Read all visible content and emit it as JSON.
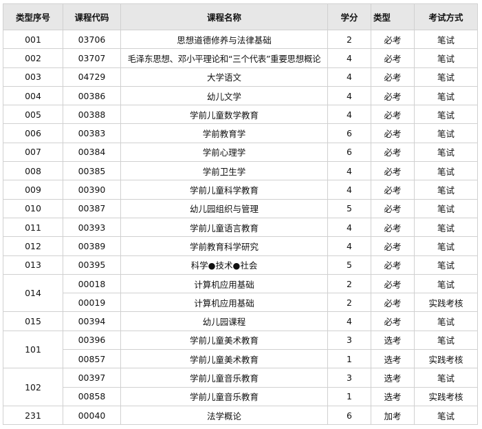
{
  "headers": {
    "seq": "类型序号",
    "code": "课程代码",
    "name": "课程名称",
    "credit": "学分",
    "type": "类型",
    "exam": "考试方式"
  },
  "rows": [
    {
      "seq": "001",
      "code": "03706",
      "name": "思想道德修养与法律基础",
      "credit": "2",
      "type": "必考",
      "exam": "笔试"
    },
    {
      "seq": "002",
      "code": "03707",
      "name": "毛泽东思想、邓小平理论和“三个代表”重要思想概论",
      "credit": "4",
      "type": "必考",
      "exam": "笔试"
    },
    {
      "seq": "003",
      "code": "04729",
      "name": "大学语文",
      "credit": "4",
      "type": "必考",
      "exam": "笔试"
    },
    {
      "seq": "004",
      "code": "00386",
      "name": "幼儿文学",
      "credit": "4",
      "type": "必考",
      "exam": "笔试"
    },
    {
      "seq": "005",
      "code": "00388",
      "name": "学前儿童数学教育",
      "credit": "4",
      "type": "必考",
      "exam": "笔试"
    },
    {
      "seq": "006",
      "code": "00383",
      "name": "学前教育学",
      "credit": "6",
      "type": "必考",
      "exam": "笔试"
    },
    {
      "seq": "007",
      "code": "00384",
      "name": "学前心理学",
      "credit": "6",
      "type": "必考",
      "exam": "笔试"
    },
    {
      "seq": "008",
      "code": "00385",
      "name": "学前卫生学",
      "credit": "4",
      "type": "必考",
      "exam": "笔试"
    },
    {
      "seq": "009",
      "code": "00390",
      "name": "学前儿童科学教育",
      "credit": "4",
      "type": "必考",
      "exam": "笔试"
    },
    {
      "seq": "010",
      "code": "00387",
      "name": "幼儿园组织与管理",
      "credit": "5",
      "type": "必考",
      "exam": "笔试"
    },
    {
      "seq": "011",
      "code": "00393",
      "name": "学前儿童语言教育",
      "credit": "4",
      "type": "必考",
      "exam": "笔试"
    },
    {
      "seq": "012",
      "code": "00389",
      "name": "学前教育科学研究",
      "credit": "4",
      "type": "必考",
      "exam": "笔试"
    },
    {
      "seq": "013",
      "code": "00395",
      "name": "科学●技术●社会",
      "credit": "5",
      "type": "必考",
      "exam": "笔试"
    },
    {
      "seq": "014",
      "code": "00018",
      "name": "计算机应用基础",
      "credit": "2",
      "type": "必考",
      "exam": "笔试"
    },
    {
      "seq": "",
      "code": "00019",
      "name": "计算机应用基础",
      "credit": "2",
      "type": "必考",
      "exam": "实践考核"
    },
    {
      "seq": "015",
      "code": "00394",
      "name": "幼儿园课程",
      "credit": "4",
      "type": "必考",
      "exam": "笔试"
    },
    {
      "seq": "101",
      "code": "00396",
      "name": "学前儿童美术教育",
      "credit": "3",
      "type": "选考",
      "exam": "笔试"
    },
    {
      "seq": "",
      "code": "00857",
      "name": "学前儿童美术教育",
      "credit": "1",
      "type": "选考",
      "exam": "实践考核"
    },
    {
      "seq": "102",
      "code": "00397",
      "name": "学前儿童音乐教育",
      "credit": "3",
      "type": "选考",
      "exam": "笔试"
    },
    {
      "seq": "",
      "code": "00858",
      "name": "学前儿童音乐教育",
      "credit": "1",
      "type": "选考",
      "exam": "实践考核"
    },
    {
      "seq": "231",
      "code": "00040",
      "name": "法学概论",
      "credit": "6",
      "type": "加考",
      "exam": "笔试"
    }
  ]
}
